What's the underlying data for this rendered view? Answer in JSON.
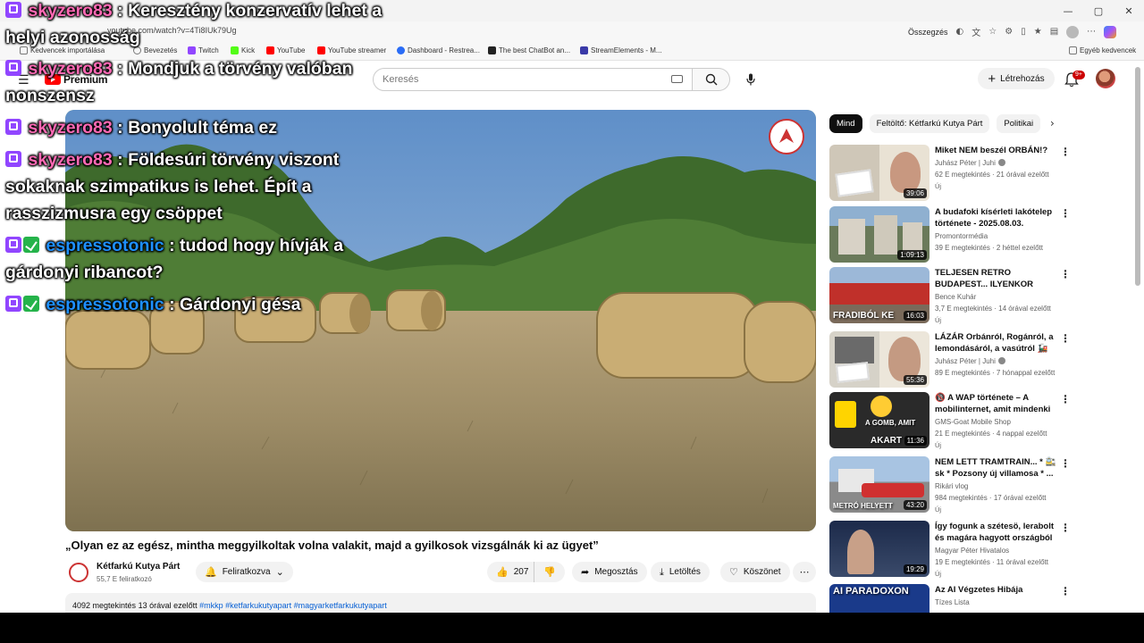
{
  "browser": {
    "url": "youtube.com/watch?v=4Ti8IUk79Ug",
    "summary_label": "Összegzés",
    "bookmarks": [
      "Kedvencek importálása",
      "Bevezetés",
      "Twitch",
      "Kick",
      "YouTube",
      "YouTube streamer",
      "Dashboard - Restrea...",
      "The best ChatBot an...",
      "StreamElements - M..."
    ],
    "other_bookmarks": "Egyéb kedvencek"
  },
  "youtube": {
    "logo_text": "Premium",
    "search_placeholder": "Keresés",
    "create_label": "Létrehozás",
    "notif_count": "9+"
  },
  "chat": [
    {
      "user": "skyzero83",
      "text": ": Keresztény konzervatív lehet a helyi azonosság",
      "badges": [
        "twitch"
      ],
      "color": "pink"
    },
    {
      "user": "skyzero83",
      "text": ": Mondjuk a törvény valóban nonszensz",
      "badges": [
        "twitch"
      ],
      "color": "pink"
    },
    {
      "user": "skyzero83",
      "text": ": Bonyolult téma ez",
      "badges": [
        "twitch"
      ],
      "color": "pink"
    },
    {
      "user": "skyzero83",
      "text": ": Földesúri törvény viszont sokaknak szimpatikus is lehet. Épít a rasszizmusra egy csöppet",
      "badges": [
        "twitch"
      ],
      "color": "pink"
    },
    {
      "user": "espressotonic",
      "text": ": tudod hogy hívják a gárdonyi ribancot?",
      "badges": [
        "twitch",
        "green"
      ],
      "color": "blue"
    },
    {
      "user": "espressotonic",
      "text": ": Gárdonyi gésa",
      "badges": [
        "twitch",
        "green"
      ],
      "color": "blue"
    }
  ],
  "video": {
    "title": "„Olyan ez az egész, mintha meggyilkoltak volna valakit, majd a gyilkosok vizsgálnák ki az ügyet”",
    "channel": "Kétfarkú Kutya Párt",
    "subscribers": "55,7 E feliratkozó",
    "subscribed_label": "Feliratkozva",
    "likes": "207",
    "share_label": "Megosztás",
    "download_label": "Letöltés",
    "thanks_label": "Köszönet",
    "views": "4092 megtekintés",
    "time_ago": "13 órával ezelőtt",
    "tags": "#mkkp #ketfarkukutyapart #magyarketfarkukutyapart"
  },
  "sidebar": {
    "chips": [
      "Mind",
      "Feltöltő: Kétfarkú Kutya Párt",
      "Politikai"
    ],
    "recommendations": [
      {
        "title": "Miket NEM beszél ORBÁN!?",
        "channel": "Juhász Péter | Juhi",
        "verified": true,
        "meta": "62 E megtekintés · 21 órával ezelőtt",
        "new": "Új",
        "duration": "39:06",
        "thumb_text": ""
      },
      {
        "title": "A budafoki kísérleti lakótelep története - 2025.08.03.",
        "channel": "Promontormédia",
        "verified": false,
        "meta": "39 E megtekintés · 2 héttel ezelőtt",
        "new": "",
        "duration": "1:09:13",
        "thumb_text": ""
      },
      {
        "title": "TELJESEN RETRO BUDAPEST... ILYENKOR FOROG A LEGTÖB...",
        "channel": "Bence Kuhár",
        "verified": false,
        "meta": "3,7 E megtekintés · 14 órával ezelőtt",
        "new": "Új",
        "duration": "16:03",
        "thumb_text": "FRADIBÓL KE"
      },
      {
        "title": "LÁZÁR Orbánról, Rogánról, a lemondásáról, a vasútról 🚂 ...",
        "channel": "Juhász Péter | Juhi",
        "verified": true,
        "meta": "89 E megtekintés · 7 hónappal ezelőtt",
        "new": "",
        "duration": "55:36",
        "thumb_text": ""
      },
      {
        "title": "🔞 A WAP története – A mobilinternet, amit mindenki ...",
        "channel": "GMS-Goat Mobile Shop",
        "verified": false,
        "meta": "21 E megtekintés · 4 nappal ezelőtt",
        "new": "Új",
        "duration": "11:36",
        "thumb_text": "AKART"
      },
      {
        "title": "NEM LETT TRAMTRAIN... * 🚉 sk * Pozsony új villamosa * ...",
        "channel": "Rikári vlog",
        "verified": false,
        "meta": "984 megtekintés · 17 órával ezelőtt",
        "new": "Új",
        "duration": "43:20",
        "thumb_text": "METRÓ HELYETT"
      },
      {
        "title": "Így fogunk a szétesö, lerabolt és magára hagyott országból ...",
        "channel": "Magyar Péter Hivatalos",
        "verified": false,
        "meta": "19 E megtekintés · 11 órával ezelőtt",
        "new": "Új",
        "duration": "19:29",
        "thumb_text": ""
      },
      {
        "title": "Az AI Végzetes Hibája",
        "channel": "Tízes Lista",
        "verified": false,
        "meta": "",
        "new": "",
        "duration": "",
        "thumb_text": "AI PARADOXON"
      }
    ]
  }
}
